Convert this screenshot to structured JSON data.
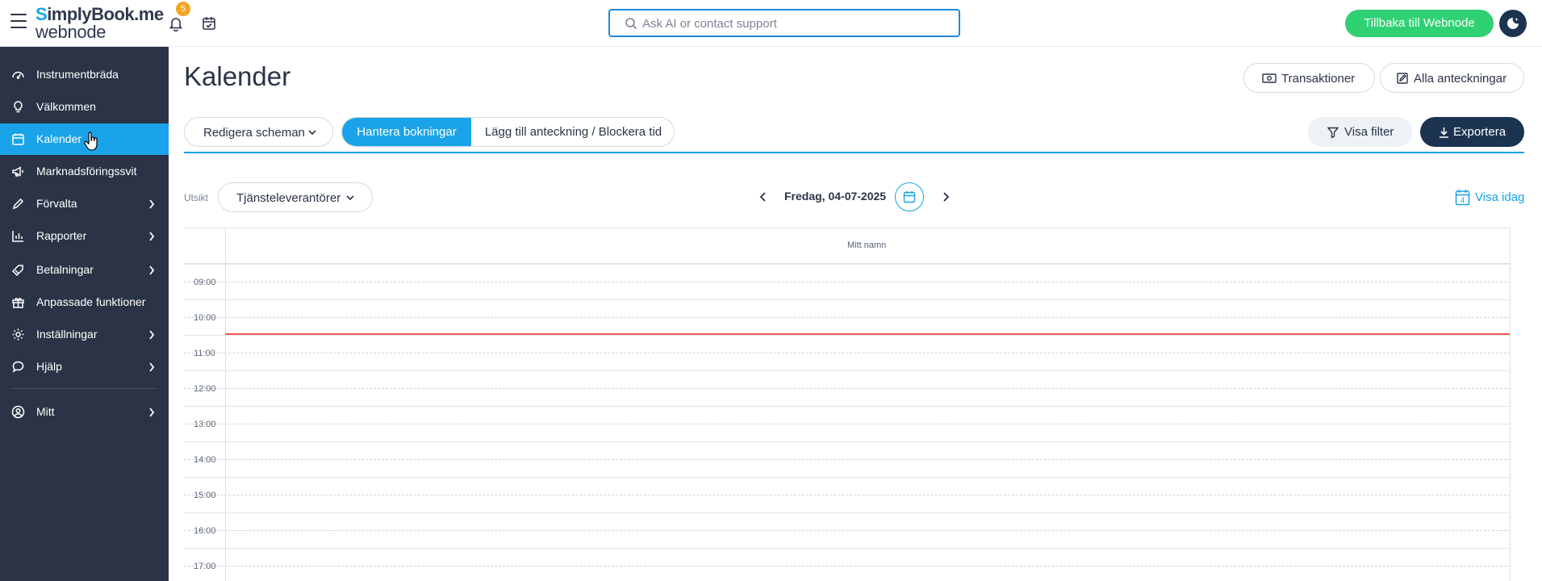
{
  "topbar": {
    "logo_line1_blue": "S",
    "logo_line1_rest": "implyBook.me",
    "logo_line2": "webnode",
    "notification_count": "5",
    "search_placeholder": "Ask AI or contact support",
    "back_button": "Tillbaka till Webnode"
  },
  "sidebar": {
    "items": [
      {
        "label": "Instrumentbräda",
        "icon": "dashboard-icon"
      },
      {
        "label": "Välkommen",
        "icon": "lightbulb-icon"
      },
      {
        "label": "Kalender",
        "icon": "calendar-icon"
      },
      {
        "label": "Marknadsföringssvit",
        "icon": "megaphone-icon"
      },
      {
        "label": "Förvalta",
        "icon": "pencil-icon"
      },
      {
        "label": "Rapporter",
        "icon": "bar-chart-icon"
      },
      {
        "label": "Betalningar",
        "icon": "tag-icon"
      },
      {
        "label": "Anpassade funktioner",
        "icon": "gift-icon"
      },
      {
        "label": "Inställningar",
        "icon": "gear-icon"
      },
      {
        "label": "Hjälp",
        "icon": "chat-bubble-icon"
      },
      {
        "label": "Mitt",
        "icon": "user-circle-icon"
      }
    ],
    "active_index": 2
  },
  "header": {
    "title": "Kalender",
    "transactions_button": "Transaktioner",
    "all_notes_button": "Alla anteckningar"
  },
  "toolbar": {
    "edit_schedules": "Redigera scheman",
    "manage_bookings": "Hantera bokningar",
    "add_note_block": "Lägg till anteckning / Blockera tid",
    "show_filter": "Visa filter",
    "export": "Exportera"
  },
  "view": {
    "label": "Utsikt",
    "selected": "Tjänsteleverantörer",
    "date": "Fredag, 04-07-2025",
    "show_today": "Visa idag",
    "today_day_number": "4"
  },
  "calendar": {
    "provider_column": "Mitt namn",
    "hours": [
      "09:00",
      "10:00",
      "11:00",
      "12:00",
      "13:00",
      "14:00",
      "15:00",
      "16:00",
      "17:00"
    ]
  },
  "colors": {
    "brand_blue": "#1aa3e8",
    "sidebar_bg": "#2b3446",
    "green_button": "#2fd173",
    "navy_button": "#1c3350",
    "now_line": "#f15555",
    "badge": "#f6a623"
  }
}
